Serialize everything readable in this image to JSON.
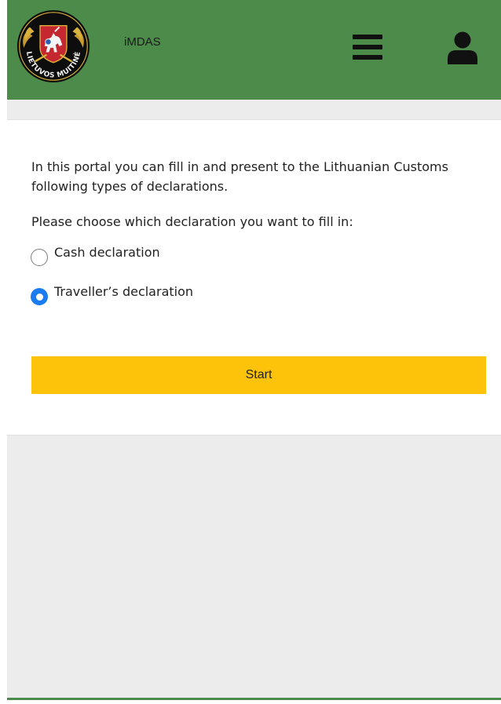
{
  "header": {
    "app_title": "iMDAS",
    "logo_text": "LIETUVOS MUITINĖ",
    "menu_icon": "hamburger-menu-icon",
    "user_icon": "user-account-icon"
  },
  "colors": {
    "header_green": "#4c8b4a",
    "start_button_yellow": "#fdc20a",
    "radio_selected_blue": "#1a7cf0",
    "background_gray": "#ececec"
  },
  "main": {
    "intro_text": "In this portal you can fill in and present to the Lithuanian Customs following types of declarations.",
    "choose_text": "Please choose which declaration you want to fill in:",
    "options": [
      {
        "label": "Cash declaration",
        "selected": false
      },
      {
        "label": "Traveller’s declaration",
        "selected": true
      }
    ],
    "start_label": "Start"
  }
}
